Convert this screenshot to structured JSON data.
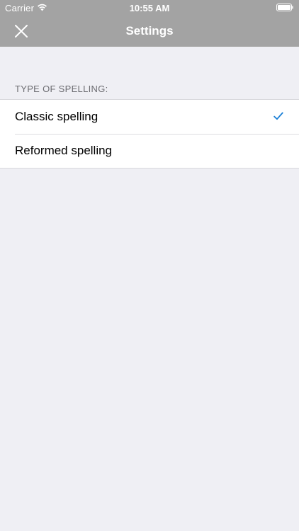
{
  "status_bar": {
    "carrier": "Carrier",
    "time": "10:55 AM"
  },
  "nav": {
    "title": "Settings",
    "close_icon": "close-icon"
  },
  "section": {
    "header": "TYPE OF SPELLING:",
    "options": [
      {
        "label": "Classic spelling",
        "selected": true
      },
      {
        "label": "Reformed spelling",
        "selected": false
      }
    ]
  },
  "colors": {
    "header_bg": "#a3a3a3",
    "page_bg": "#efeff4",
    "accent": "#1a7fd6",
    "section_text": "#6d6d72"
  }
}
